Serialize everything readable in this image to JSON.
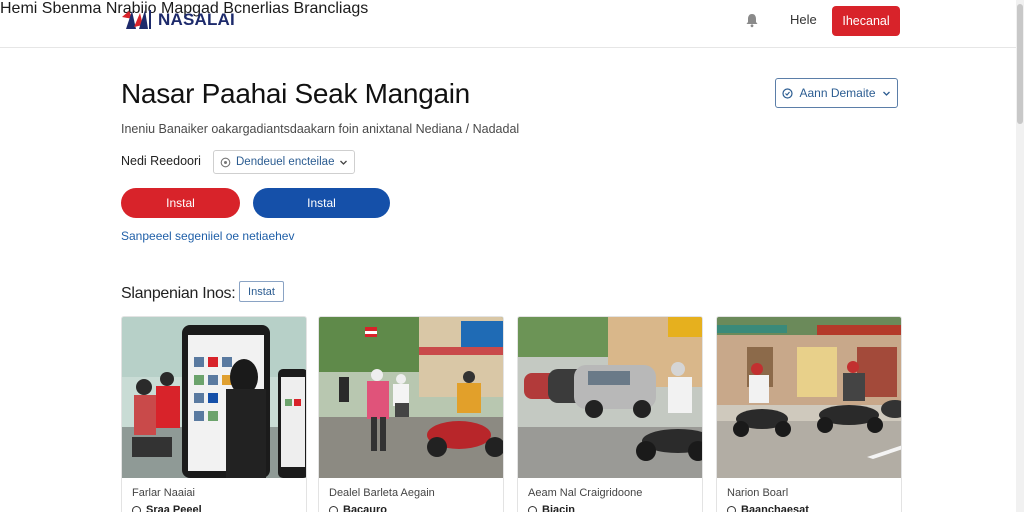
{
  "brand": {
    "name": "NASALAI",
    "colors": {
      "red": "#d8232a",
      "navy": "#1d2a6b",
      "blue": "#1550a9"
    }
  },
  "nav": {
    "items": [
      {
        "label": "Hemi"
      },
      {
        "label": "Sbenma"
      },
      {
        "label": "Nrabiio"
      },
      {
        "label": "Mapgad"
      },
      {
        "label": "Bcnerlias"
      },
      {
        "label": "Brancliags"
      }
    ],
    "help_label": "Hele",
    "cta_label": "Ihecanal"
  },
  "hero": {
    "title": "Nasar Paahai Seak Mangain",
    "subtitle": "Ineniu Banaiker oakargadiantsdaakarn foin anixtanal Nediana / Nadadal",
    "demo_button": "Aann Demaite",
    "select_label": "Nedi Reedoori",
    "select_value": "Dendeuel encteilae",
    "install_red": "Instal",
    "install_blue": "Instal",
    "link": "Sanpeeel segeniiel oe netiaehev"
  },
  "section": {
    "title": "Slanpenian Inos:",
    "chip": "Instat"
  },
  "cards": [
    {
      "caption": "Farlar Naaiai",
      "meta": "Sraa Peeel"
    },
    {
      "caption": "Dealel Barleta Aegain",
      "meta": "Bacauro"
    },
    {
      "caption": "Aeam Nal Craigridoone",
      "meta": "Biacin"
    },
    {
      "caption": "Narion Boarl",
      "meta": "Baanchaesat"
    }
  ],
  "icons": {
    "logo": "flag-logo-icon",
    "bell": "bell-icon",
    "demo": "info-circle-icon",
    "select": "clock-icon",
    "chevron": "chevron-down-icon"
  }
}
